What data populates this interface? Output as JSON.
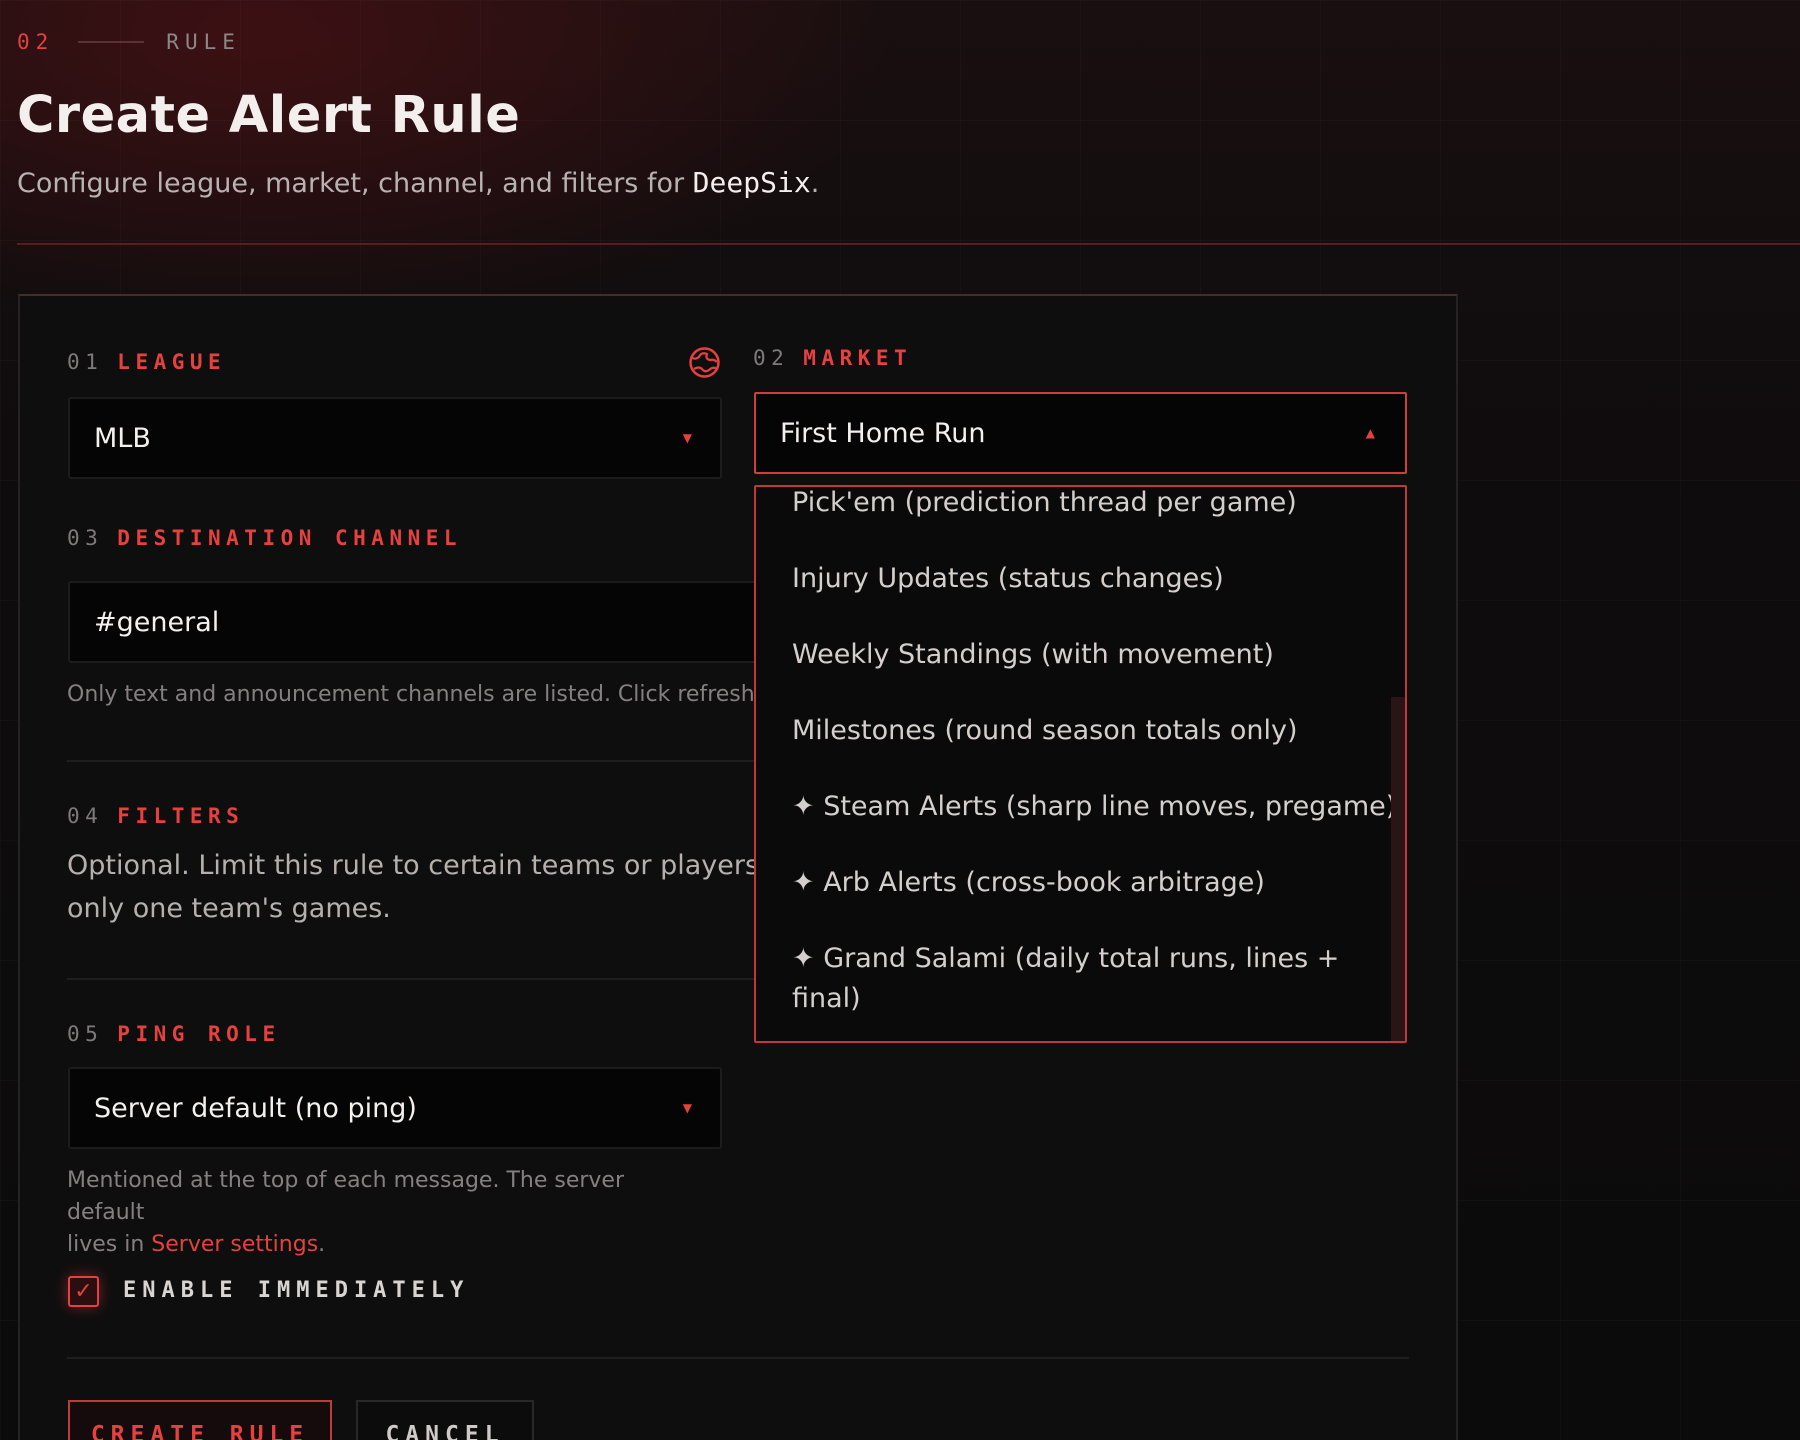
{
  "header": {
    "step_number": "02",
    "step_label": "RULE",
    "title": "Create Alert Rule",
    "subtitle_prefix": "Configure league, market, channel, and filters for ",
    "brand": "DeepSix",
    "subtitle_suffix": "."
  },
  "league": {
    "number": "01",
    "label": "LEAGUE",
    "value": "MLB"
  },
  "market": {
    "number": "02",
    "label": "MARKET",
    "value": "First Home Run",
    "options": [
      "Pick'em (prediction thread per game)",
      "Injury Updates (status changes)",
      "Weekly Standings (with movement)",
      "Milestones (round season totals only)",
      "✦ Steam Alerts (sharp line moves, pregame)",
      "✦ Arb Alerts (cross-book arbitrage)",
      "✦ Grand Salami (daily total runs, lines +",
      "final)"
    ]
  },
  "channel": {
    "number": "03",
    "label": "DESTINATION CHANNEL",
    "value": "#general",
    "help": "Only text and announcement channels are listed. Click refresh to"
  },
  "filters": {
    "number": "04",
    "label": "FILTERS",
    "description_line1": "Optional. Limit this rule to certain teams or players — e",
    "description_line2": "only one team's games."
  },
  "ping_role": {
    "number": "05",
    "label": "PING ROLE",
    "value": "Server default (no ping)",
    "help_line1": "Mentioned at the top of each message. The server default",
    "help_line2_prefix": "lives in ",
    "help_link": "Server settings",
    "help_line2_suffix": "."
  },
  "enable": {
    "label": "ENABLE IMMEDIATELY",
    "checked": true
  },
  "actions": {
    "create_label": "CREATE RULE",
    "cancel_label": "CANCEL"
  },
  "icons": {
    "globe": "globe-icon",
    "caret_down": "caret-down-icon",
    "caret_up": "caret-up-icon",
    "check": "check-icon"
  },
  "colors": {
    "accent": "#e5413e",
    "background": "#0d0c0d",
    "input_bg": "#050505"
  }
}
